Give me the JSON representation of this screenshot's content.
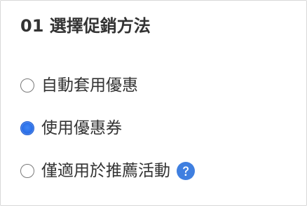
{
  "section": {
    "title": "01 選擇促銷方法"
  },
  "options": [
    {
      "label": "自動套用優惠",
      "selected": false
    },
    {
      "label": "使用優惠券",
      "selected": true
    },
    {
      "label": "僅適用於推薦活動",
      "selected": false,
      "icon": "question-circle-icon"
    }
  ],
  "colors": {
    "accent": "#2b6fe8",
    "help_icon": "#3f7fe0",
    "text": "#333333",
    "border": "#d8d8d8"
  }
}
